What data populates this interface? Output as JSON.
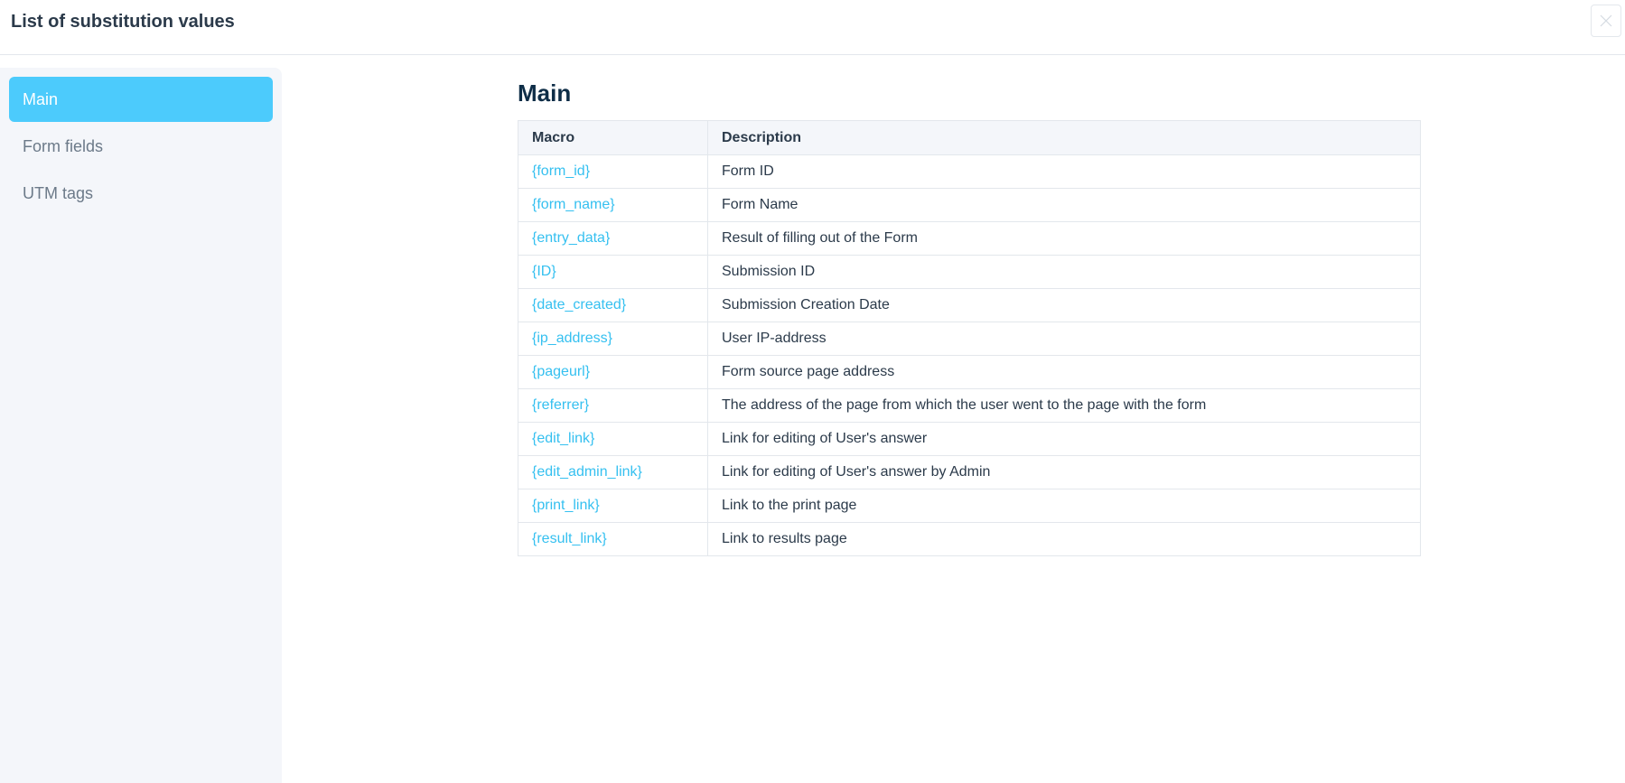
{
  "modal": {
    "title": "List of substitution values"
  },
  "sidebar": {
    "items": [
      {
        "label": "Main",
        "active": true
      },
      {
        "label": "Form fields",
        "active": false
      },
      {
        "label": "UTM tags",
        "active": false
      }
    ]
  },
  "main": {
    "section_title": "Main",
    "table": {
      "headers": {
        "macro": "Macro",
        "description": "Description"
      },
      "rows": [
        {
          "macro": "{form_id}",
          "description": "Form ID"
        },
        {
          "macro": "{form_name}",
          "description": "Form Name"
        },
        {
          "macro": "{entry_data}",
          "description": "Result of filling out of the Form"
        },
        {
          "macro": "{ID}",
          "description": "Submission ID"
        },
        {
          "macro": "{date_created}",
          "description": "Submission Creation Date"
        },
        {
          "macro": "{ip_address}",
          "description": "User IP-address"
        },
        {
          "macro": "{pageurl}",
          "description": "Form source page address"
        },
        {
          "macro": "{referrer}",
          "description": "The address of the page from which the user went to the page with the form"
        },
        {
          "macro": "{edit_link}",
          "description": "Link for editing of User's answer"
        },
        {
          "macro": "{edit_admin_link}",
          "description": "Link for editing of User's answer by Admin"
        },
        {
          "macro": "{print_link}",
          "description": "Link to the print page"
        },
        {
          "macro": "{result_link}",
          "description": "Link to results page"
        }
      ]
    }
  },
  "icons": {
    "close": "close-icon"
  },
  "colors": {
    "accent": "#4ccbfc",
    "macro_link": "#35c0f0",
    "sidebar_bg": "#f4f6fa",
    "title": "#0e2d47"
  }
}
